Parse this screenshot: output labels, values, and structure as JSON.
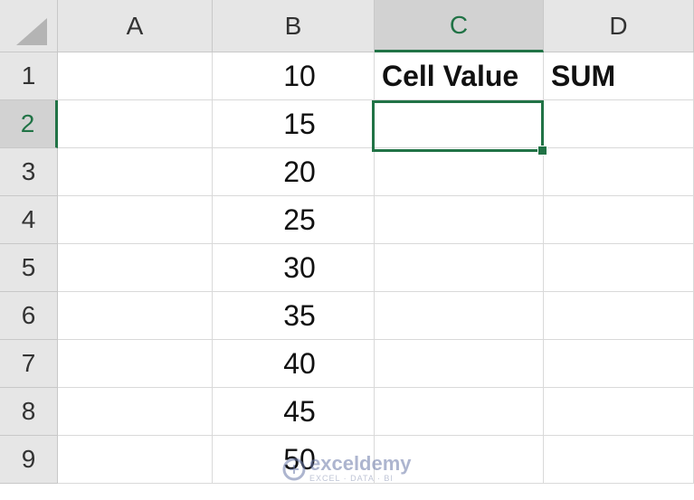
{
  "columns": [
    "A",
    "B",
    "C",
    "D"
  ],
  "active_column": "C",
  "rows": [
    "1",
    "2",
    "3",
    "4",
    "5",
    "6",
    "7",
    "8",
    "9"
  ],
  "active_row": "2",
  "cells": {
    "B1": "10",
    "B2": "15",
    "B3": "20",
    "B4": "25",
    "B5": "30",
    "B6": "35",
    "B7": "40",
    "B8": "45",
    "B9": "50",
    "C1": "Cell Value",
    "D1": "SUM"
  },
  "selected_cell": "C2",
  "watermark": {
    "name": "exceldemy",
    "tagline": "EXCEL · DATA · BI"
  },
  "colors": {
    "accent": "#217346",
    "header_bg": "#e6e6e6",
    "grid": "#d9d9d9"
  }
}
